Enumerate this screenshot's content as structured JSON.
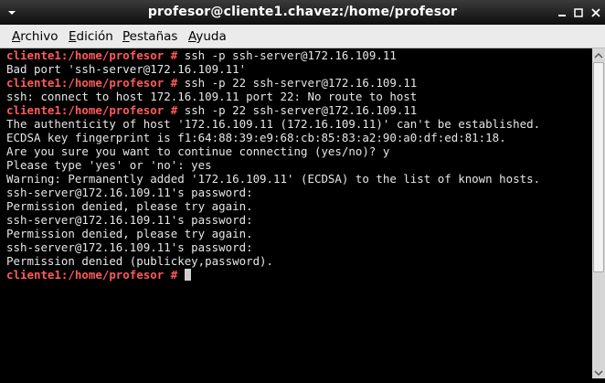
{
  "window": {
    "title": "profesor@cliente1.chavez:/home/profesor"
  },
  "menu": [
    {
      "first": "A",
      "rest": "rchivo"
    },
    {
      "first": "E",
      "rest": "dición"
    },
    {
      "first": "P",
      "rest": "estañas"
    },
    {
      "first": "A",
      "rest": "yuda"
    }
  ],
  "terminal": {
    "prompt": "cliente1:/home/profesor # ",
    "lines": [
      {
        "prompt": true,
        "text": "ssh -p ssh-server@172.16.109.11"
      },
      {
        "prompt": false,
        "text": "Bad port 'ssh-server@172.16.109.11'"
      },
      {
        "prompt": true,
        "text": "ssh -p 22 ssh-server@172.16.109.11"
      },
      {
        "prompt": false,
        "text": "ssh: connect to host 172.16.109.11 port 22: No route to host"
      },
      {
        "prompt": true,
        "text": "ssh -p 22 ssh-server@172.16.109.11"
      },
      {
        "prompt": false,
        "text": "The authenticity of host '172.16.109.11 (172.16.109.11)' can't be established."
      },
      {
        "prompt": false,
        "text": "ECDSA key fingerprint is f1:64:88:39:e9:68:cb:85:83:a2:90:a0:df:ed:81:18."
      },
      {
        "prompt": false,
        "text": "Are you sure you want to continue connecting (yes/no)? y"
      },
      {
        "prompt": false,
        "text": "Please type 'yes' or 'no': yes"
      },
      {
        "prompt": false,
        "text": "Warning: Permanently added '172.16.109.11' (ECDSA) to the list of known hosts."
      },
      {
        "prompt": false,
        "text": "ssh-server@172.16.109.11's password:"
      },
      {
        "prompt": false,
        "text": "Permission denied, please try again."
      },
      {
        "prompt": false,
        "text": "ssh-server@172.16.109.11's password:"
      },
      {
        "prompt": false,
        "text": "Permission denied, please try again."
      },
      {
        "prompt": false,
        "text": "ssh-server@172.16.109.11's password:"
      },
      {
        "prompt": false,
        "text": "Permission denied (publickey,password)."
      },
      {
        "prompt": true,
        "text": "",
        "cursor": true
      }
    ]
  },
  "colors": {
    "prompt": "#ff5a5a",
    "text": "#e6e6e6",
    "background": "#000000"
  }
}
